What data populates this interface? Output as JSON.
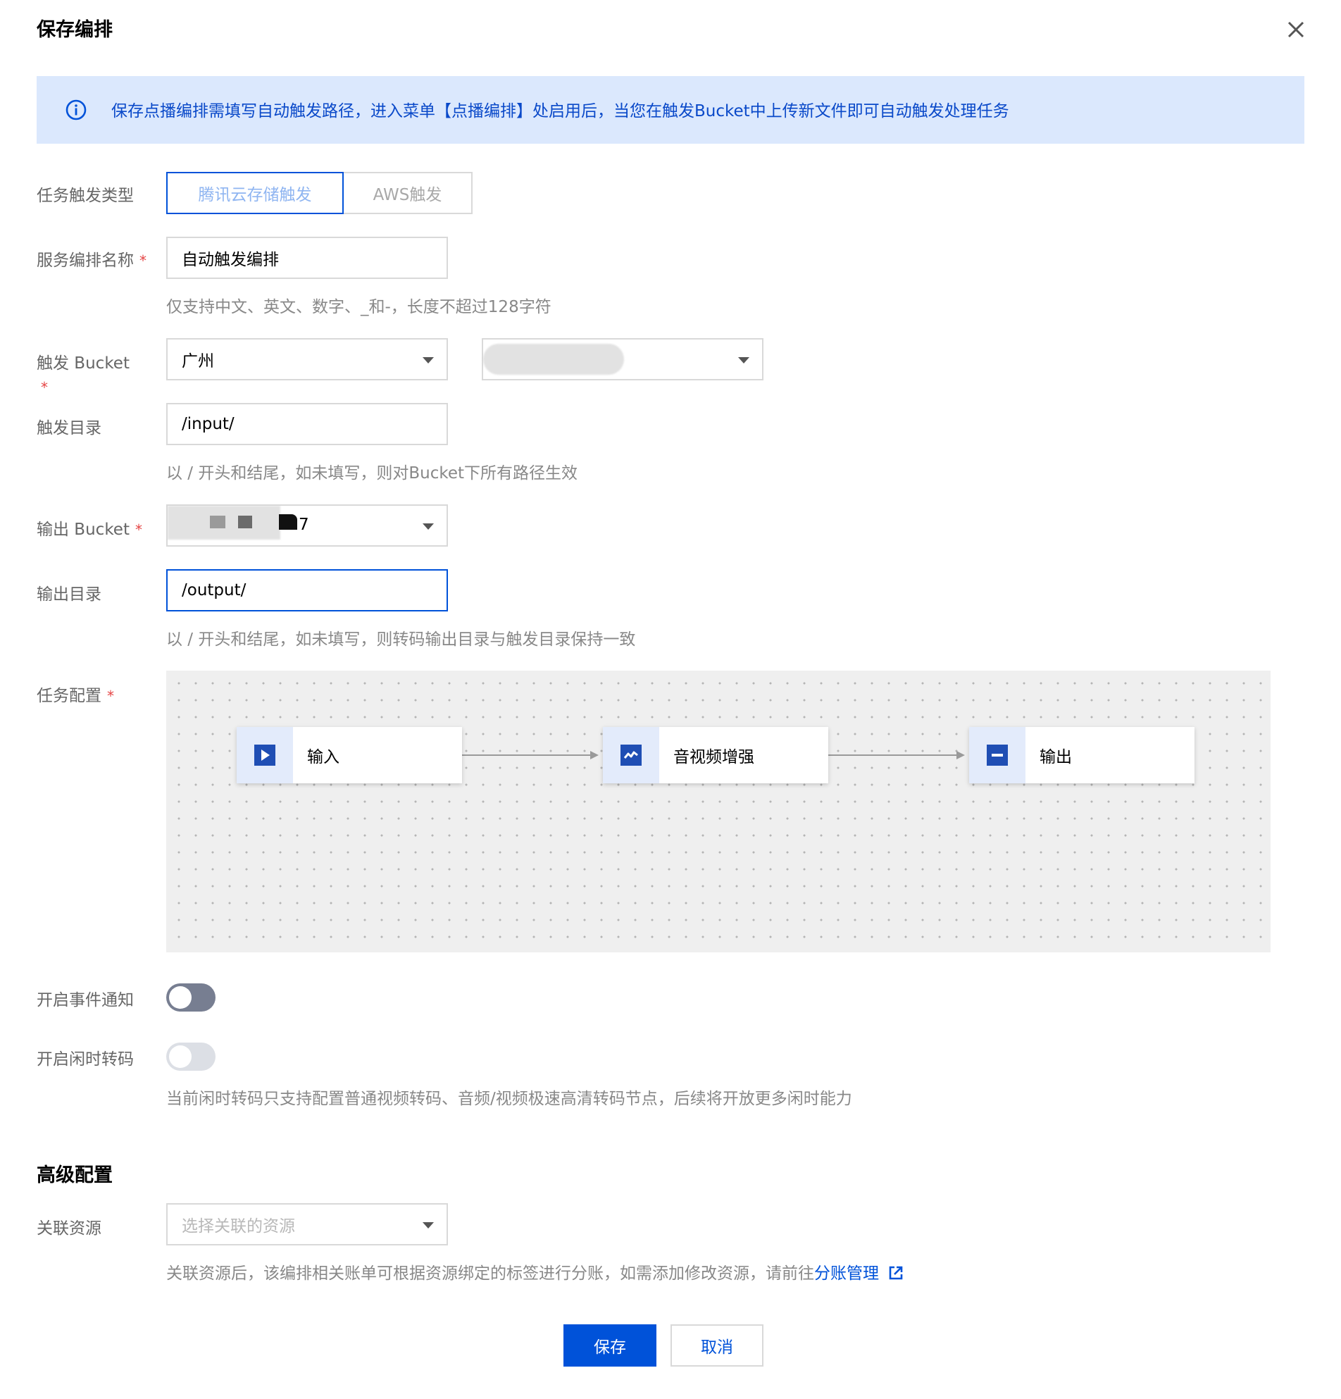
{
  "dialog": {
    "title": "保存编排",
    "close_icon": "close-icon"
  },
  "alert": {
    "icon": "info-icon",
    "text": "保存点播编排需填写自动触发路径，进入菜单【点播编排】处启用后，当您在触发Bucket中上传新文件即可自动触发处理任务"
  },
  "form": {
    "trigger_type": {
      "label": "任务触发类型",
      "options": [
        "腾讯云存储触发",
        "AWS触发"
      ],
      "selected": "腾讯云存储触发"
    },
    "service_name": {
      "label": "服务编排名称",
      "required_mark": "*",
      "value": "自动触发编排",
      "hint": "仅支持中文、英文、数字、_和-，长度不超过128字符"
    },
    "trigger_bucket": {
      "label": "触发 Bucket",
      "required_mark": "*",
      "region_value": "广州",
      "bucket_value": ""
    },
    "trigger_dir": {
      "label": "触发目录",
      "value": "/input/",
      "hint": "以 / 开头和结尾，如未填写，则对Bucket下所有路径生效"
    },
    "output_bucket": {
      "label": "输出 Bucket",
      "required_mark": "*",
      "value_suffix": "7"
    },
    "output_dir": {
      "label": "输出目录",
      "value": "/output/",
      "hint": "以 / 开头和结尾，如未填写，则转码输出目录与触发目录保持一致"
    },
    "task_config": {
      "label": "任务配置",
      "required_mark": "*",
      "nodes": [
        {
          "label": "输入",
          "icon": "play-icon"
        },
        {
          "label": "音视频增强",
          "icon": "enhance-icon"
        },
        {
          "label": "输出",
          "icon": "output-icon"
        }
      ]
    },
    "event_notify": {
      "label": "开启事件通知",
      "on": false
    },
    "idle_transcode": {
      "label": "开启闲时转码",
      "on": false,
      "hint": "当前闲时转码只支持配置普通视频转码、音频/视频极速高清转码节点，后续将开放更多闲时能力"
    }
  },
  "advanced": {
    "title": "高级配置",
    "resource": {
      "label": "关联资源",
      "placeholder": "选择关联的资源",
      "hint_prefix": "关联资源后，该编排相关账单可根据资源绑定的标签进行分账，如需添加修改资源，请前往",
      "link_text": "分账管理",
      "link_icon": "external-link-icon"
    }
  },
  "footer": {
    "save_label": "保存",
    "cancel_label": "取消"
  },
  "colors": {
    "primary": "#0052d9",
    "alert_bg": "#dbe8fd",
    "required": "#e54545"
  }
}
